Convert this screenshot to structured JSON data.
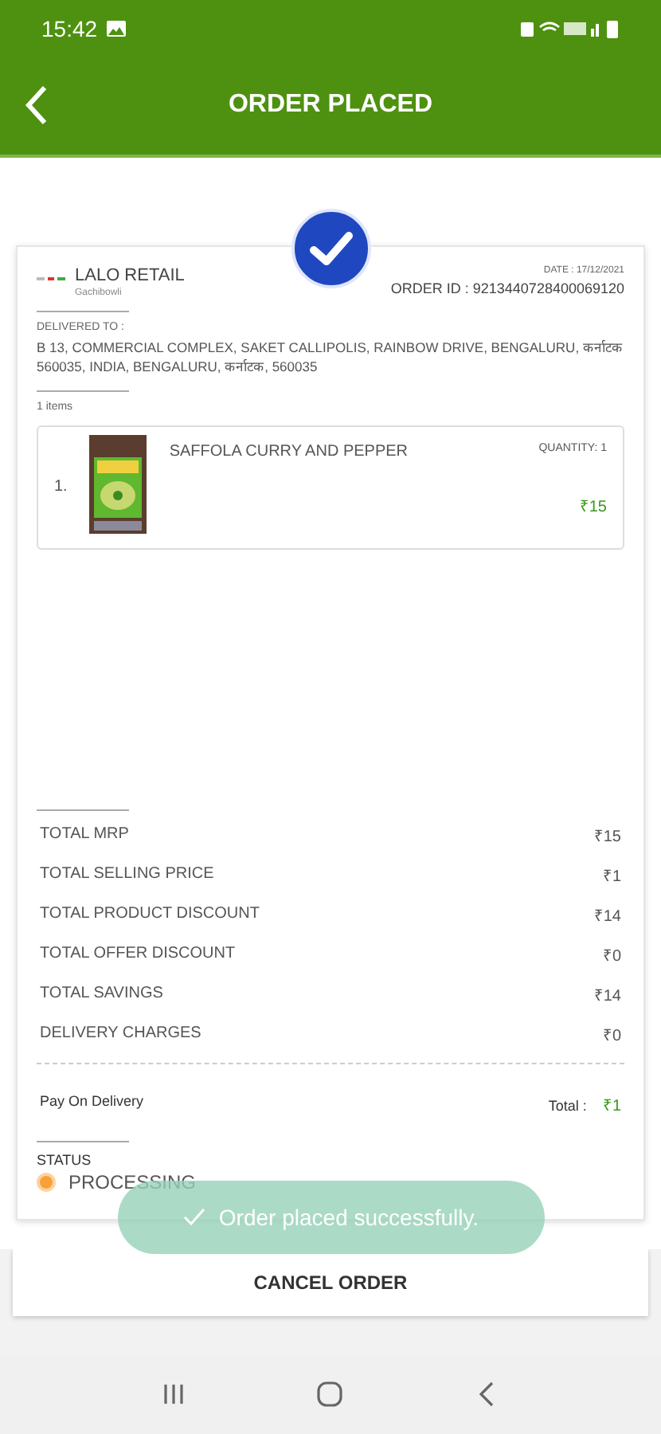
{
  "status_bar": {
    "time": "15:42"
  },
  "app_bar": {
    "title": "ORDER PLACED"
  },
  "order": {
    "store": "LALO RETAIL",
    "store_area": "Gachibowli",
    "date": "DATE : 17/12/2021",
    "order_id": "ORDER ID : 9213440728400069120",
    "delivered_label": "DELIVERED TO :",
    "address": "B 13, COMMERCIAL COMPLEX, SAKET CALLIPOLIS, RAINBOW DRIVE, BENGALURU, कर्नाटक 560035, INDIA, BENGALURU, कर्नाटक, 560035",
    "items_count": "1 items",
    "items": [
      {
        "index": "1.",
        "name": "SAFFOLA CURRY AND PEPPER",
        "quantity": "QUANTITY: 1",
        "price": "₹15"
      }
    ],
    "totals": [
      {
        "label": "TOTAL MRP",
        "value": "₹15"
      },
      {
        "label": "TOTAL SELLING PRICE",
        "value": "₹1"
      },
      {
        "label": "TOTAL PRODUCT DISCOUNT",
        "value": "₹14"
      },
      {
        "label": "TOTAL OFFER DISCOUNT",
        "value": "₹0"
      },
      {
        "label": "TOTAL SAVINGS",
        "value": "₹14"
      },
      {
        "label": "DELIVERY CHARGES",
        "value": "₹0"
      }
    ],
    "payment": "Pay On Delivery",
    "total_label": "Total :",
    "total_value": "₹1",
    "status_label": "STATUS",
    "status": {
      "text": "PROCESSING",
      "color": "#f7a13a"
    }
  },
  "toast": "Order placed successfully.",
  "cancel_button": "CANCEL ORDER"
}
